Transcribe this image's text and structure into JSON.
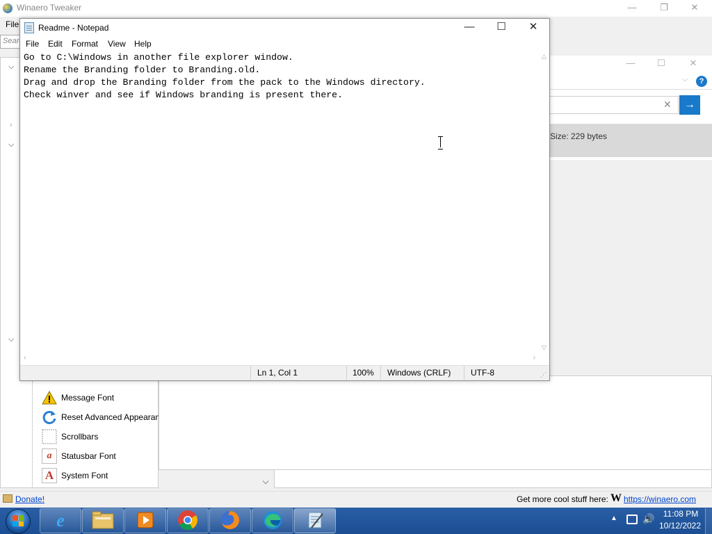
{
  "winaero": {
    "title": "Winaero Tweaker",
    "menu_file": "File",
    "search_placeholder": "Search",
    "tree_items": [
      {
        "label": "Message Font",
        "icon": "warning-icon"
      },
      {
        "label": "Reset Advanced Appearance",
        "icon": "reset-icon"
      },
      {
        "label": "Scrollbars",
        "icon": "scrollbars-icon"
      },
      {
        "label": "Statusbar Font",
        "icon": "statusbar-font-icon"
      },
      {
        "label": "System Font",
        "icon": "system-font-icon"
      }
    ],
    "donate": "Donate!",
    "cool_stuff": "Get more cool stuff here:",
    "logo_letter": "W",
    "link": "https://winaero.com"
  },
  "properties": {
    "size_text": "Size: 229 bytes",
    "help": "?"
  },
  "notepad": {
    "title": "Readme - Notepad",
    "menu": [
      "File",
      "Edit",
      "Format",
      "View",
      "Help"
    ],
    "lines": [
      "Go to C:\\Windows in another file explorer window.",
      "Rename the Branding folder to Branding.old.",
      "Drag and drop the Branding folder from the pack to the Windows directory.",
      "Check winver and see if Windows branding is present there."
    ],
    "status": {
      "position": "Ln 1, Col 1",
      "zoom": "100%",
      "line_ending": "Windows (CRLF)",
      "encoding": "UTF-8"
    }
  },
  "taskbar": {
    "apps": [
      {
        "name": "internet-explorer",
        "icon": "internet-explorer-icon"
      },
      {
        "name": "file-explorer",
        "icon": "folder-icon"
      },
      {
        "name": "media-player",
        "icon": "media-player-icon"
      },
      {
        "name": "chrome",
        "icon": "chrome-icon"
      },
      {
        "name": "firefox",
        "icon": "firefox-icon"
      },
      {
        "name": "edge",
        "icon": "edge-icon"
      },
      {
        "name": "notepad",
        "icon": "notepad-icon"
      }
    ],
    "time": "11:08 PM",
    "date": "10/12/2022"
  },
  "colors": {
    "taskbar": "#1f5299",
    "accent": "#1979ca",
    "link": "#0044cc"
  }
}
